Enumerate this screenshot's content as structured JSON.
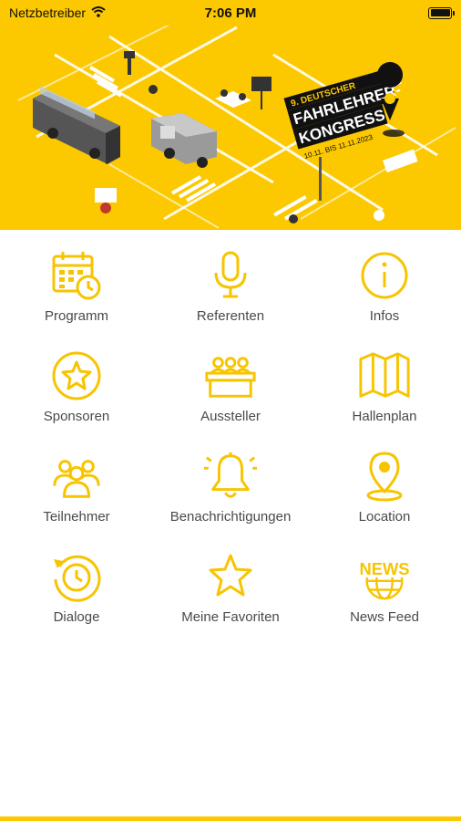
{
  "status": {
    "carrier": "Netzbetreiber",
    "time": "7:06 PM",
    "battery_level": 1.0
  },
  "hero": {
    "banner_line1": "9. DEUTSCHER",
    "banner_line2": "FAHRLEHRER-",
    "banner_line3": "KONGRESS",
    "banner_dates": "10.11. BIS 11.11.2023"
  },
  "menu": [
    {
      "label": "Programm",
      "icon": "calendar-clock-icon"
    },
    {
      "label": "Referenten",
      "icon": "microphone-icon"
    },
    {
      "label": "Infos",
      "icon": "info-icon"
    },
    {
      "label": "Sponsoren",
      "icon": "star-badge-icon"
    },
    {
      "label": "Aussteller",
      "icon": "exhibitors-icon"
    },
    {
      "label": "Hallenplan",
      "icon": "map-icon"
    },
    {
      "label": "Teilnehmer",
      "icon": "participants-icon"
    },
    {
      "label": "Benachrichtigungen",
      "icon": "bell-icon"
    },
    {
      "label": "Location",
      "icon": "location-pin-icon"
    },
    {
      "label": "Dialoge",
      "icon": "clock-refresh-icon"
    },
    {
      "label": "Meine Favoriten",
      "icon": "star-icon"
    },
    {
      "label": "News Feed",
      "icon": "news-globe-icon"
    }
  ],
  "colors": {
    "accent": "#fcc800",
    "icon": "#f7c400",
    "label": "#4a4a4a"
  }
}
